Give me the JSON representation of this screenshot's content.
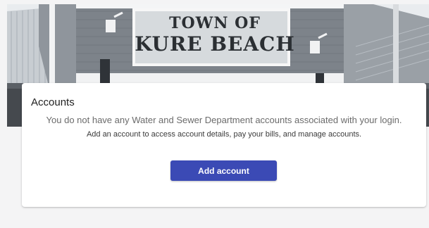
{
  "hero": {
    "sign_line1": "TOWN OF",
    "sign_line2": "KURE BEACH"
  },
  "card": {
    "title": "Accounts",
    "message": "You do not have any Water and Sewer Department accounts associated with your login.",
    "submessage": "Add an account to access account details, pay your bills, and manage accounts.",
    "add_button_label": "Add account"
  },
  "colors": {
    "primary": "#3b4ab5",
    "background": "#f4f4f5",
    "card": "#ffffff"
  }
}
